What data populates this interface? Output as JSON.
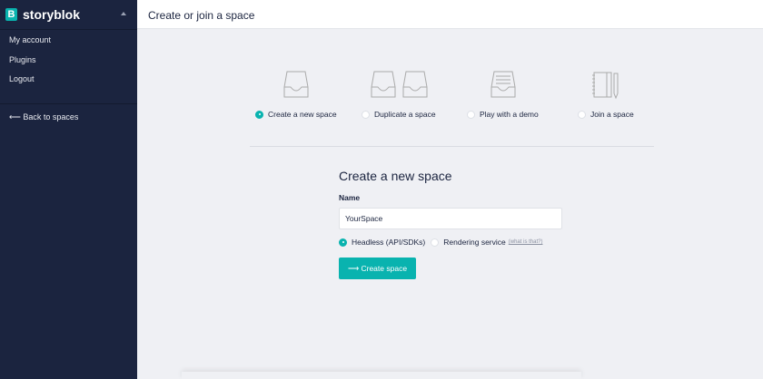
{
  "sidebar": {
    "brand": "storyblok",
    "logo_letter": "B",
    "items": [
      {
        "label": "My account"
      },
      {
        "label": "Plugins"
      },
      {
        "label": "Logout"
      }
    ],
    "back_label": "⟵ Back to spaces"
  },
  "header": {
    "title": "Create or join a space"
  },
  "options": [
    {
      "label": "Create a new space",
      "selected": true
    },
    {
      "label": "Duplicate a space",
      "selected": false
    },
    {
      "label": "Play with a demo",
      "selected": false
    },
    {
      "label": "Join a space",
      "selected": false
    }
  ],
  "form": {
    "title": "Create a new space",
    "name_label": "Name",
    "name_value": "YourSpace",
    "type_headless": "Headless (API/SDKs)",
    "type_rendering": "Rendering service",
    "what_link": "(what is that?)",
    "submit_label": "⟶ Create space"
  },
  "colors": {
    "accent": "#09b3af",
    "sidebar": "#1b243f"
  }
}
